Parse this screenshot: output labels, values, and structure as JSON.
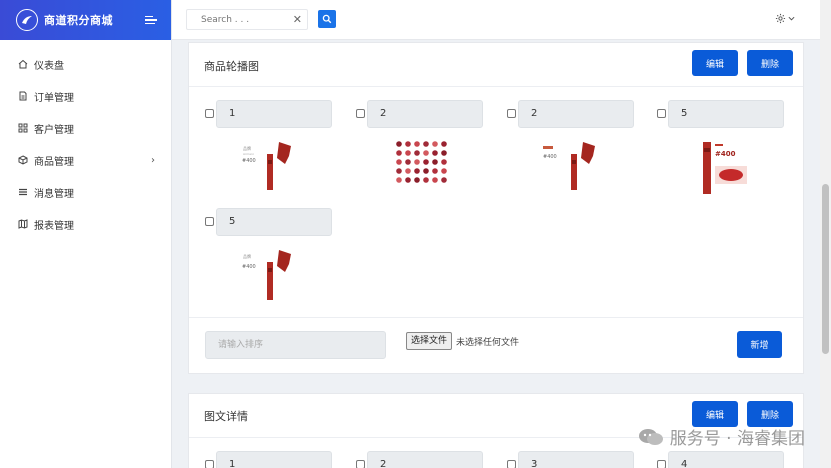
{
  "brand": {
    "title": "商道积分商城"
  },
  "sidebar": {
    "items": [
      {
        "label": "仪表盘",
        "icon": "home-icon"
      },
      {
        "label": "订单管理",
        "icon": "document-icon"
      },
      {
        "label": "客户管理",
        "icon": "grid-icon"
      },
      {
        "label": "商品管理",
        "icon": "box-icon",
        "has_arrow": true
      },
      {
        "label": "消息管理",
        "icon": "list-icon"
      },
      {
        "label": "报表管理",
        "icon": "map-icon"
      }
    ]
  },
  "topbar": {
    "search_placeholder": "Search . . ."
  },
  "carousel": {
    "title": "商品轮播图",
    "edit_label": "编辑",
    "delete_label": "删除",
    "items": [
      {
        "order": "1",
        "image": "lipstick-ad"
      },
      {
        "order": "2",
        "image": "color-swatches"
      },
      {
        "order": "2",
        "image": "lipstick-ad"
      },
      {
        "order": "5",
        "image": "lipstick-promo"
      },
      {
        "order": "5",
        "image": "lipstick-ad"
      }
    ],
    "sort_placeholder": "请输入排序",
    "file_button": "选择文件",
    "file_status": "未选择任何文件",
    "add_label": "新增"
  },
  "detail": {
    "title": "图文详情",
    "edit_label": "编辑",
    "delete_label": "删除",
    "items": [
      {
        "order": "1"
      },
      {
        "order": "2"
      },
      {
        "order": "3"
      },
      {
        "order": "4"
      }
    ]
  },
  "watermark": {
    "text": "服务号 · 海睿集团"
  },
  "colors": {
    "primary": "#0a5bd8",
    "brand_gradient_start": "#3a4bd6",
    "brand_gradient_end": "#2a5fe4"
  }
}
